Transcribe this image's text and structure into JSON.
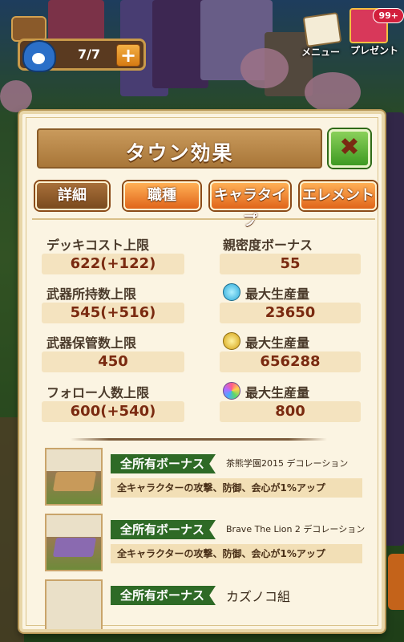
{
  "hud": {
    "stamina": "7/7",
    "plus_label": "+",
    "menu_label": "メニュー",
    "present_label": "プレゼント",
    "present_count": "99+"
  },
  "panel": {
    "title": "タウン効果",
    "close_symbol": "✖"
  },
  "tabs": [
    {
      "label": "詳細",
      "active": true
    },
    {
      "label": "職種",
      "active": false
    },
    {
      "label": "キャラタイプ",
      "active": false
    },
    {
      "label": "エレメント",
      "active": false
    }
  ],
  "stats_left": [
    {
      "label": "デッキコスト上限",
      "value": "622(+122)"
    },
    {
      "label": "武器所持数上限",
      "value": "545(+516)"
    },
    {
      "label": "武器保管数上限",
      "value": "450"
    },
    {
      "label": "フォロー人数上限",
      "value": "600(+540)"
    }
  ],
  "stats_right": [
    {
      "label": "親密度ボーナス",
      "value": "55",
      "icon": ""
    },
    {
      "label": "最大生産量",
      "value": "23650",
      "icon": "water-drop-icon"
    },
    {
      "label": "最大生産量",
      "value": "656288",
      "icon": "gold-coin-icon"
    },
    {
      "label": "最大生産量",
      "value": "800",
      "icon": "rainbow-gem-icon"
    }
  ],
  "bonuses": [
    {
      "tag": "全所有ボーナス",
      "name": "茶熊学園2015 デコレーション",
      "desc": "全キャラクターの攻撃、防御、会心が1%アップ"
    },
    {
      "tag": "全所有ボーナス",
      "name": "Brave The Lion 2 デコレーション",
      "desc": "全キャラクターの攻撃、防御、会心が1%アップ"
    },
    {
      "tag": "全所有ボーナス",
      "name": "カズノコ組",
      "desc": ""
    }
  ],
  "colors": {
    "panel_bg": "#fbf4e2",
    "active_tab": "#8a5428",
    "inactive_tab": "#f08a2e",
    "ribbon": "#2e6a26",
    "value_text": "#7a2a10",
    "close_button": "#5cb232"
  }
}
